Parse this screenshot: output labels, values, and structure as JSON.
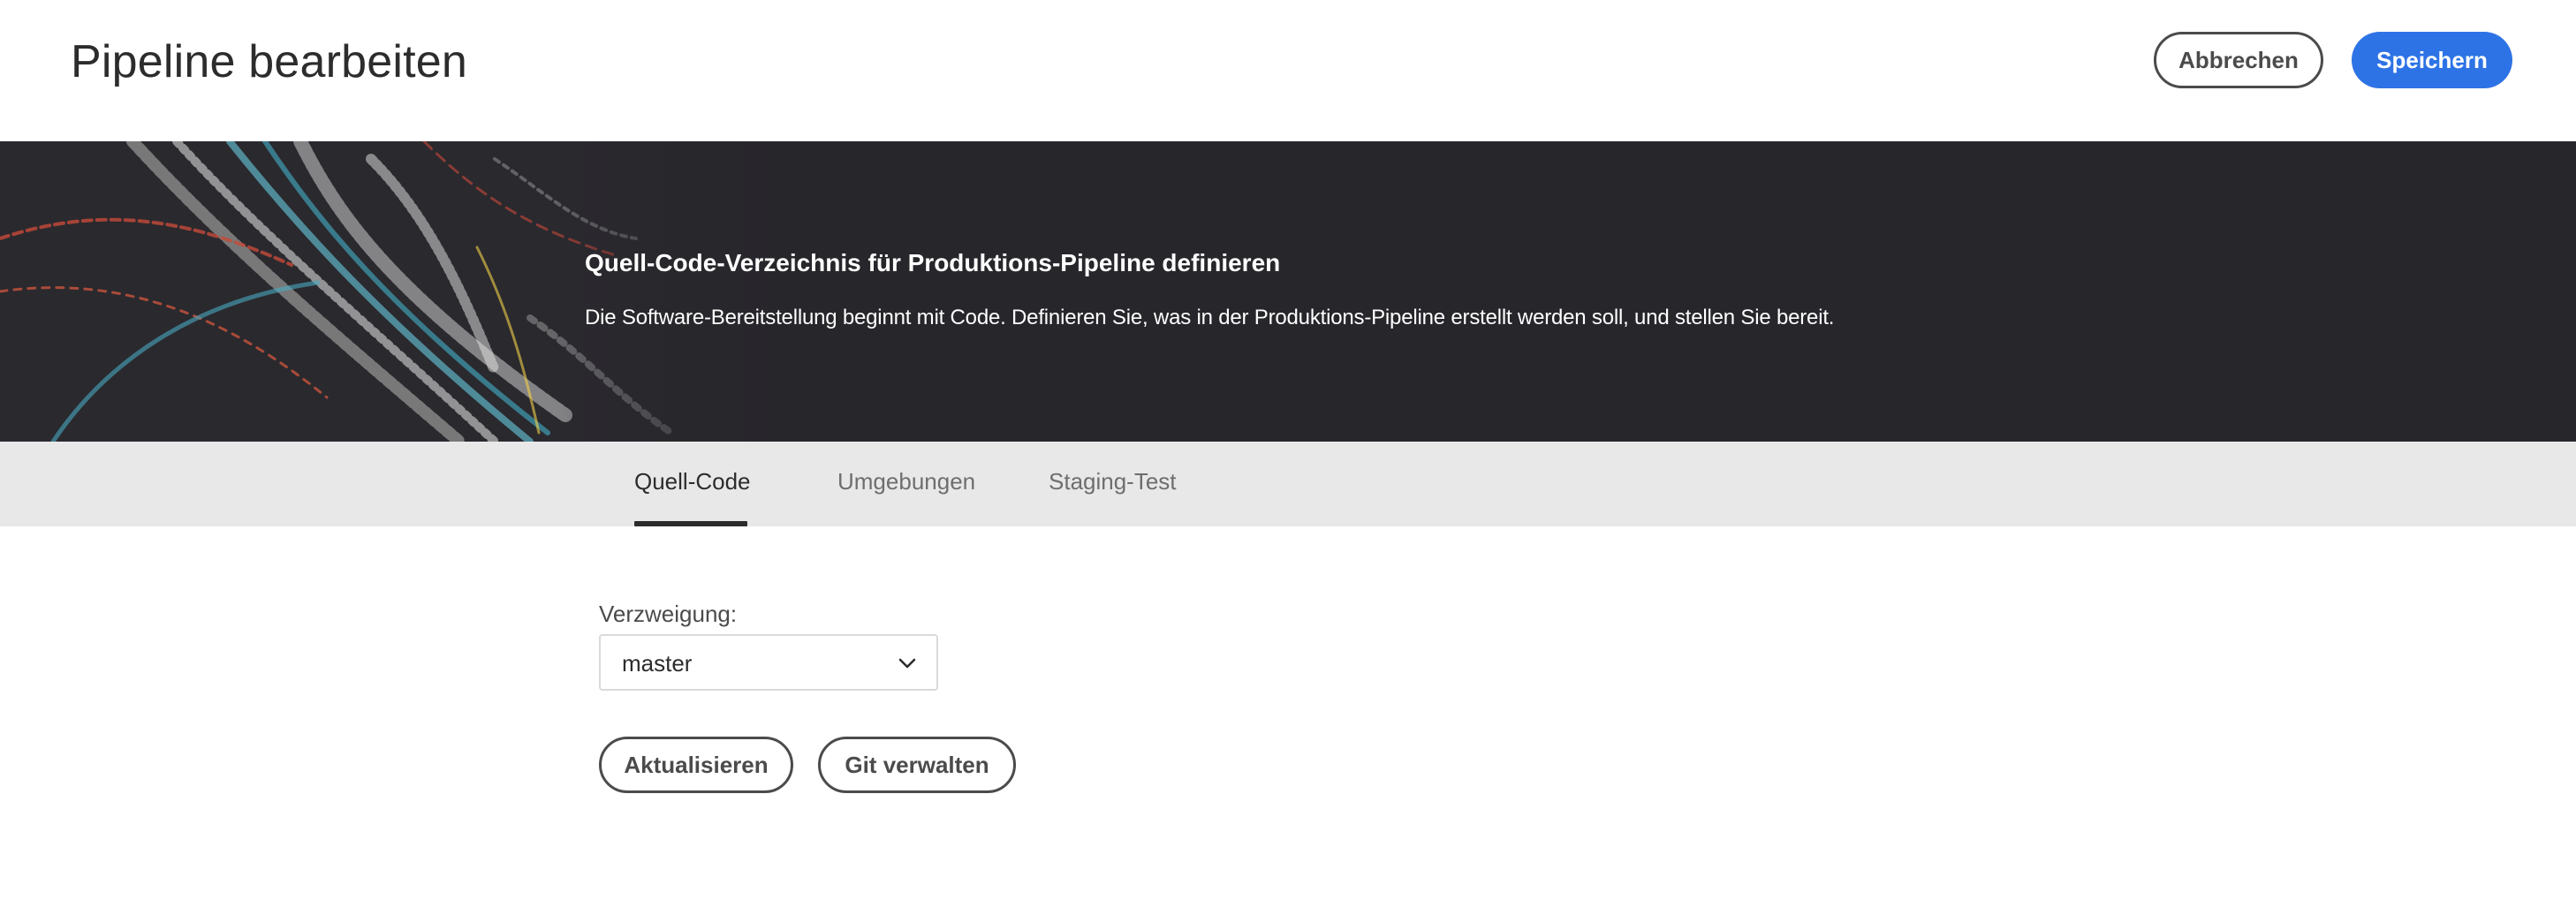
{
  "header": {
    "title": "Pipeline bearbeiten",
    "cancel_label": "Abbrechen",
    "save_label": "Speichern"
  },
  "banner": {
    "title": "Quell-Code-Verzeichnis für Produktions-Pipeline definieren",
    "description": "Die Software-Bereitstellung beginnt mit Code. Definieren Sie, was in der Produktions-Pipeline erstellt werden soll, und stellen Sie bereit."
  },
  "tabs": [
    {
      "label": "Quell-Code",
      "active": true
    },
    {
      "label": "Umgebungen",
      "active": false
    },
    {
      "label": "Staging-Test",
      "active": false
    }
  ],
  "form": {
    "branch_label": "Verzweigung:",
    "branch_value": "master",
    "refresh_label": "Aktualisieren",
    "git_label": "Git verwalten"
  },
  "colors": {
    "primary": "#2d73e6",
    "banner_bg": "#27262b",
    "tabbar_bg": "#e8e8e8",
    "text": "#2c2c2c"
  },
  "icons": {
    "select_chevron": "chevron-down-icon"
  }
}
